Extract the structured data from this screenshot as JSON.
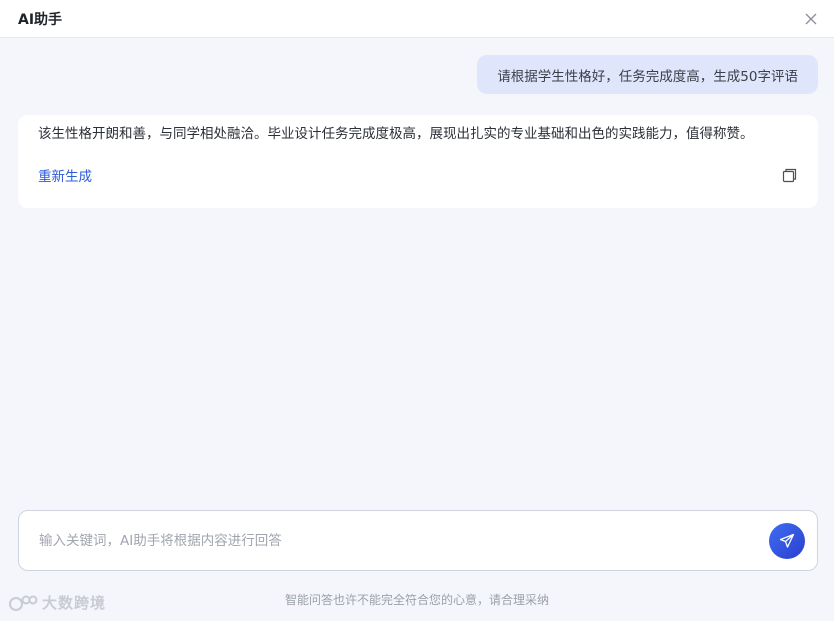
{
  "window": {
    "title": "AI助手",
    "close_icon": "close-icon"
  },
  "chat": {
    "user_message": "请根据学生性格好，任务完成度高，生成50字评语",
    "ai_reply": "该生性格开朗和善，与同学相处融洽。毕业设计任务完成度极高，展现出扎实的专业基础和出色的实践能力，值得称赞。",
    "regenerate_label": "重新生成",
    "copy_icon": "copy-icon"
  },
  "input": {
    "placeholder": "输入关键词，AI助手将根据内容进行回答",
    "value": "",
    "send_icon": "send-icon"
  },
  "footer": {
    "disclaimer": "智能问答也许不能完全符合您的心意，请合理采纳"
  },
  "watermark": {
    "text": "大数跨境"
  },
  "colors": {
    "background": "#f4f6fb",
    "user_bubble": "#dfe6fb",
    "link": "#2e5bd8",
    "send_button": "#3152e0"
  }
}
